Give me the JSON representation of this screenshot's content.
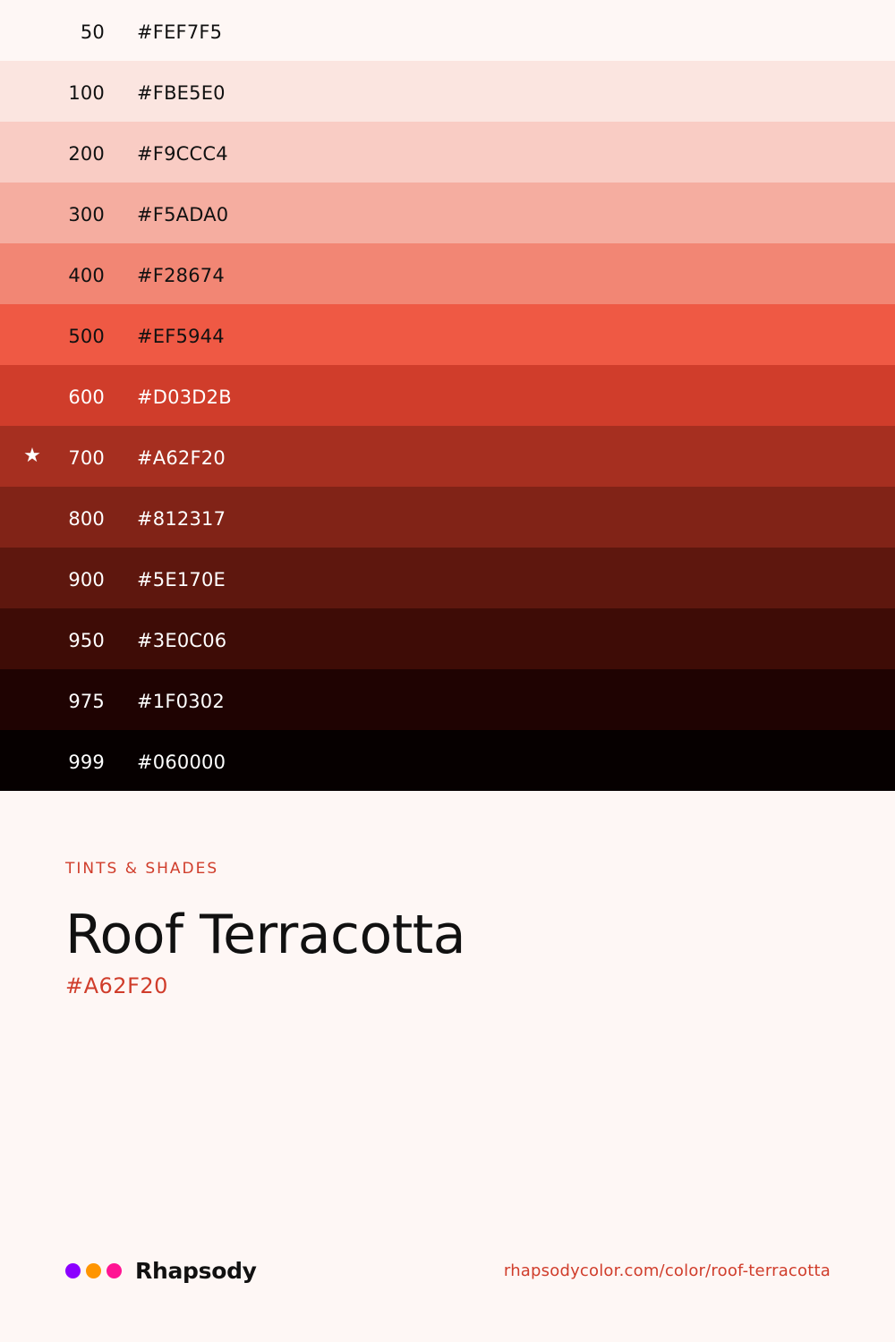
{
  "swatches": [
    {
      "step": "50",
      "hex": "#FEF7F5",
      "bg": "#FEF7F5",
      "fg": "#111111",
      "star": ""
    },
    {
      "step": "100",
      "hex": "#FBE5E0",
      "bg": "#FBE5E0",
      "fg": "#111111",
      "star": ""
    },
    {
      "step": "200",
      "hex": "#F9CCC4",
      "bg": "#F9CCC4",
      "fg": "#111111",
      "star": ""
    },
    {
      "step": "300",
      "hex": "#F5ADA0",
      "bg": "#F5ADA0",
      "fg": "#111111",
      "star": ""
    },
    {
      "step": "400",
      "hex": "#F28674",
      "bg": "#F28674",
      "fg": "#111111",
      "star": ""
    },
    {
      "step": "500",
      "hex": "#EF5944",
      "bg": "#EF5944",
      "fg": "#111111",
      "star": ""
    },
    {
      "step": "600",
      "hex": "#D03D2B",
      "bg": "#D03D2B",
      "fg": "#FFFFFF",
      "star": ""
    },
    {
      "step": "700",
      "hex": "#A62F20",
      "bg": "#A62F20",
      "fg": "#FFFFFF",
      "star": "★"
    },
    {
      "step": "800",
      "hex": "#812317",
      "bg": "#812317",
      "fg": "#FFFFFF",
      "star": ""
    },
    {
      "step": "900",
      "hex": "#5E170E",
      "bg": "#5E170E",
      "fg": "#FFFFFF",
      "star": ""
    },
    {
      "step": "950",
      "hex": "#3E0C06",
      "bg": "#3E0C06",
      "fg": "#FFFFFF",
      "star": ""
    },
    {
      "step": "975",
      "hex": "#1F0302",
      "bg": "#1F0302",
      "fg": "#FFFFFF",
      "star": ""
    },
    {
      "step": "999",
      "hex": "#060000",
      "bg": "#060000",
      "fg": "#FFFFFF",
      "star": ""
    }
  ],
  "info": {
    "eyebrow": "TINTS & SHADES",
    "title": "Roof Terracotta",
    "hex": "#A62F20"
  },
  "footer": {
    "brand": "Rhapsody",
    "dots": [
      "#8B00FF",
      "#FF9500",
      "#FF1493"
    ],
    "url": "rhapsodycolor.com/color/roof-terracotta"
  }
}
